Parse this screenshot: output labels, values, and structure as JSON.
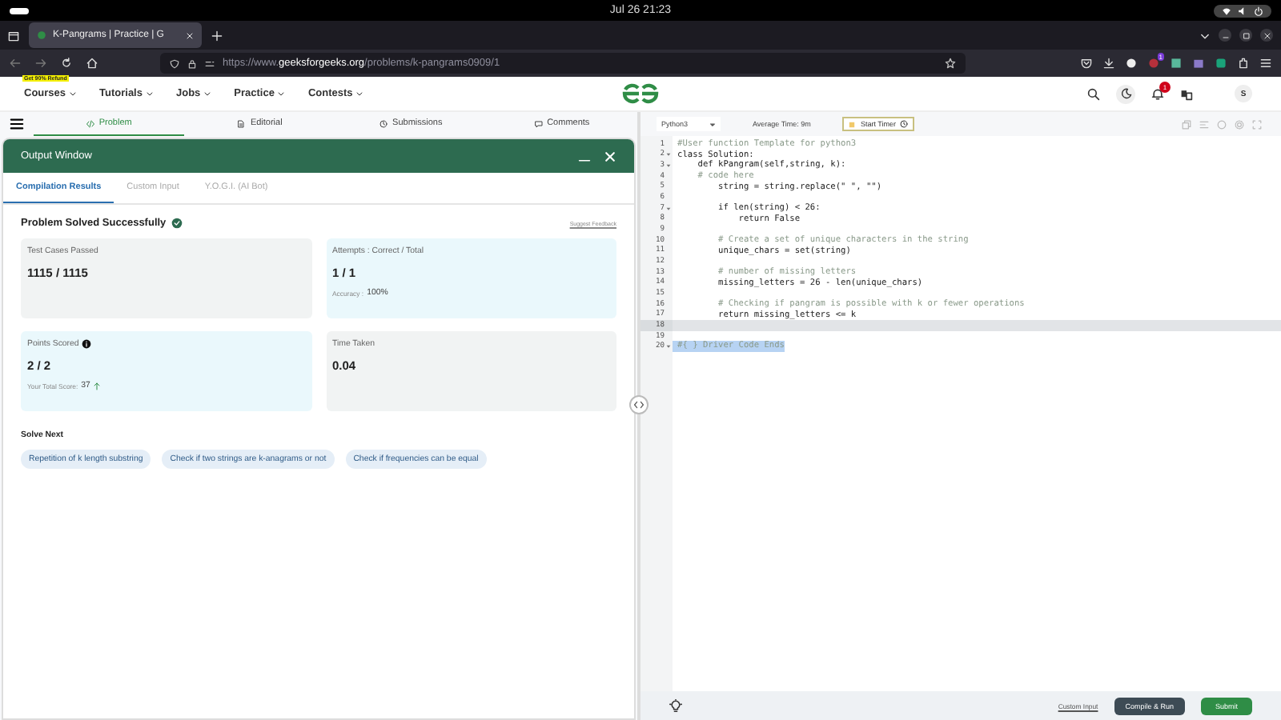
{
  "system_bar": {
    "date_time": "Jul 26  21:23"
  },
  "browser": {
    "tab": {
      "title": "K-Pangrams | Practice | G",
      "selected": true
    },
    "url": "https://www.**geeksforgeeks.org**/problems/k-pangrams0909/1",
    "extension_badge": "1"
  },
  "site_header": {
    "promo_badge": "Get 90% Refund",
    "menu": [
      {
        "label": "Courses"
      },
      {
        "label": "Tutorials"
      },
      {
        "label": "Jobs"
      },
      {
        "label": "Practice"
      },
      {
        "label": "Contests"
      }
    ],
    "notification_count": "1",
    "avatar": "S"
  },
  "problem_tabs": [
    {
      "label": "Problem",
      "selected": true
    },
    {
      "label": "Editorial",
      "selected": false
    },
    {
      "label": "Submissions",
      "selected": false
    },
    {
      "label": "Comments",
      "selected": false
    }
  ],
  "output_window": {
    "title": "Output Window",
    "tabs": [
      {
        "label": "Compilation Results",
        "selected": true
      },
      {
        "label": "Custom Input",
        "selected": false
      },
      {
        "label": "Y.O.G.I. (AI Bot)",
        "selected": false
      }
    ],
    "status": "Problem Solved Successfully",
    "feedback_link": "Suggest Feedback",
    "cards": [
      {
        "label": "Test Cases Passed",
        "value": "1115 / 1115",
        "color": "#f1f3f3",
        "info": false
      },
      {
        "label": "Attempts : Correct / Total",
        "value": "1 / 1",
        "note_label": "Accuracy :",
        "note_value": "100%",
        "color": "#eaf8fc",
        "info": false
      },
      {
        "label": "Points Scored",
        "value": "2 / 2",
        "note_label": "Your Total Score:",
        "note_value": "37",
        "rising": true,
        "color": "#eaf8fc",
        "info": true
      },
      {
        "label": "Time Taken",
        "value": "0.04",
        "color": "#f1f3f3",
        "info": false
      }
    ],
    "solve_next": {
      "title": "Solve Next",
      "items": [
        "Repetition of k length substring",
        "Check if two strings are k-anagrams or not",
        "Check if frequencies can be equal"
      ]
    }
  },
  "editor": {
    "language": "Python3",
    "average_time": "Average Time: 9m",
    "timer_button": "Start Timer",
    "lines": [
      {
        "number": "1",
        "text": "#User function Template for python3",
        "kind": "comment",
        "foldable": false,
        "active": false,
        "selected": false
      },
      {
        "number": "2",
        "text": "class Solution:",
        "kind": "code",
        "foldable": true,
        "active": false,
        "selected": false
      },
      {
        "number": "3",
        "text": "    def kPangram(self,string, k):",
        "kind": "code",
        "foldable": true,
        "active": false,
        "selected": false
      },
      {
        "number": "4",
        "text": "    # code here",
        "kind": "comment",
        "foldable": false,
        "active": false,
        "selected": false
      },
      {
        "number": "5",
        "text": "        string = string.replace(\" \", \"\")",
        "kind": "code",
        "foldable": false,
        "active": false,
        "selected": false
      },
      {
        "number": "6",
        "foldable": false,
        "active": false
      },
      {
        "number": "7",
        "text": "        if len(string) < 26:",
        "kind": "code",
        "foldable": true,
        "active": false,
        "selected": false
      },
      {
        "number": "8",
        "text": "            return False",
        "kind": "code",
        "foldable": false,
        "active": false,
        "selected": false
      },
      {
        "number": "9",
        "foldable": false,
        "active": false
      },
      {
        "number": "10",
        "text": "        # Create a set of unique characters in the string",
        "kind": "comment",
        "foldable": false,
        "active": false,
        "selected": false
      },
      {
        "number": "11",
        "text": "        unique_chars = set(string)",
        "kind": "code",
        "foldable": false,
        "active": false,
        "selected": false
      },
      {
        "number": "12",
        "foldable": false,
        "active": false
      },
      {
        "number": "13",
        "text": "        # number of missing letters",
        "kind": "comment",
        "foldable": false,
        "active": false,
        "selected": false
      },
      {
        "number": "14",
        "text": "        missing_letters = 26 - len(unique_chars)",
        "kind": "code",
        "foldable": false,
        "active": false,
        "selected": false
      },
      {
        "number": "15",
        "foldable": false,
        "active": false
      },
      {
        "number": "16",
        "text": "        # Checking if pangram is possible with k or fewer operations",
        "kind": "comment",
        "foldable": false,
        "active": false,
        "selected": false
      },
      {
        "number": "17",
        "text": "        return missing_letters <= k",
        "kind": "code",
        "foldable": false,
        "active": false,
        "selected": false
      },
      {
        "number": "18",
        "foldable": false,
        "active": true
      },
      {
        "number": "19",
        "foldable": false,
        "active": false
      },
      {
        "number": "20",
        "text": "#{ } Driver Code Ends",
        "kind": "comment",
        "foldable": true,
        "active": false,
        "selected": true
      }
    ],
    "custom_input_link": "Custom Input",
    "compile_button": "Compile & Run",
    "submit_button": "Submit"
  }
}
